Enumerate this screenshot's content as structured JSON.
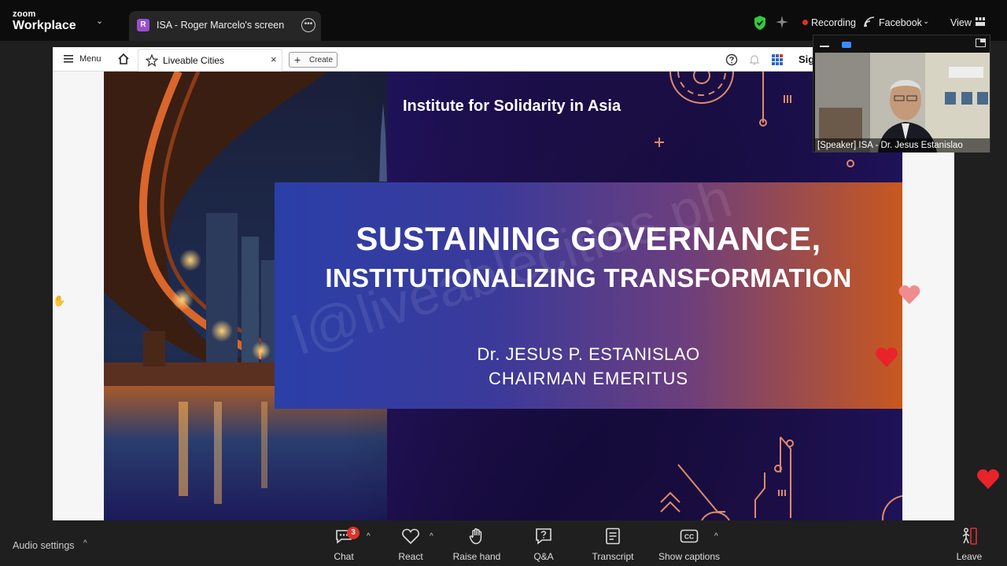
{
  "app": {
    "brand_line1": "zoom",
    "brand_line2": "Workplace"
  },
  "tab": {
    "badge": "R",
    "title": "ISA - Roger Marcelo's screen"
  },
  "status": {
    "recording_label": "Recording",
    "livestream_label": "Facebook",
    "view_label": "View"
  },
  "shared_app": {
    "menu_label": "Menu",
    "tab_label": "Liveable Cities",
    "tab_close": "×",
    "create_label": "Create",
    "sign_label": "Sig"
  },
  "slide": {
    "organization": "Institute for Solidarity in Asia",
    "title_line1": "SUSTAINING GOVERNANCE,",
    "title_line2": "INSTITUTIONALIZING TRANSFORMATION",
    "presenter": "Dr. JESUS P. ESTANISLAO",
    "presenter_title": "CHAIRMAN EMERITUS",
    "watermark": "l@liveablecities.ph"
  },
  "speaker": {
    "name": "[Speaker] ISA - Dr. Jesus Estanislao"
  },
  "toolbar": {
    "audio_settings": "Audio settings",
    "chat": "Chat",
    "chat_badge": "3",
    "react": "React",
    "raise_hand": "Raise hand",
    "qa": "Q&A",
    "transcript": "Transcript",
    "captions": "Show captions",
    "leave": "Leave"
  },
  "colors": {
    "recording": "#e0302a",
    "shield": "#2ecc40",
    "leave": "#e0302a",
    "heart": "#e8232a",
    "heart_light": "#f08c8c"
  }
}
